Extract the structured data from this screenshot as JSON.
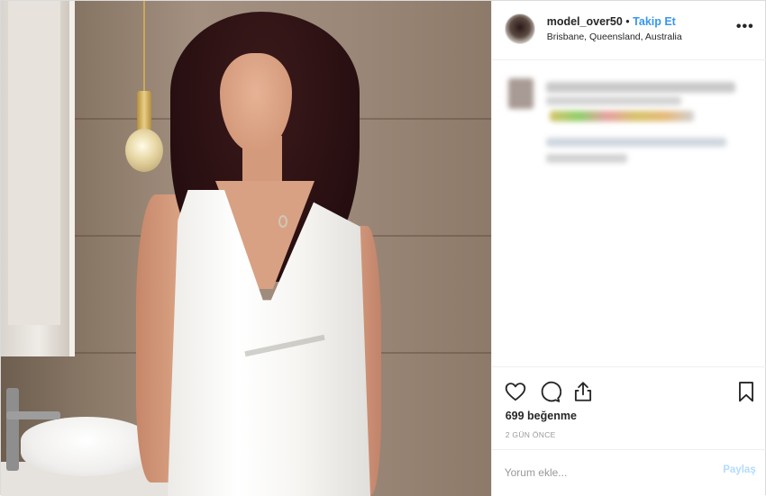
{
  "header": {
    "username": "model_over50",
    "separator": "•",
    "follow_label": "Takip Et",
    "location": "Brisbane, Queensland, Australia",
    "more_label": "•••"
  },
  "actions": {
    "like_icon": "heart-icon",
    "comment_icon": "comment-icon",
    "share_icon": "share-icon",
    "save_icon": "bookmark-icon"
  },
  "likes_text": "699 beğenme",
  "timestamp": "2 GÜN ÖNCE",
  "comment": {
    "placeholder": "Yorum ekle...",
    "post_label": "Paylaş"
  },
  "colors": {
    "link": "#3897f0",
    "post_disabled": "#b3dbff",
    "border": "#efefef"
  }
}
